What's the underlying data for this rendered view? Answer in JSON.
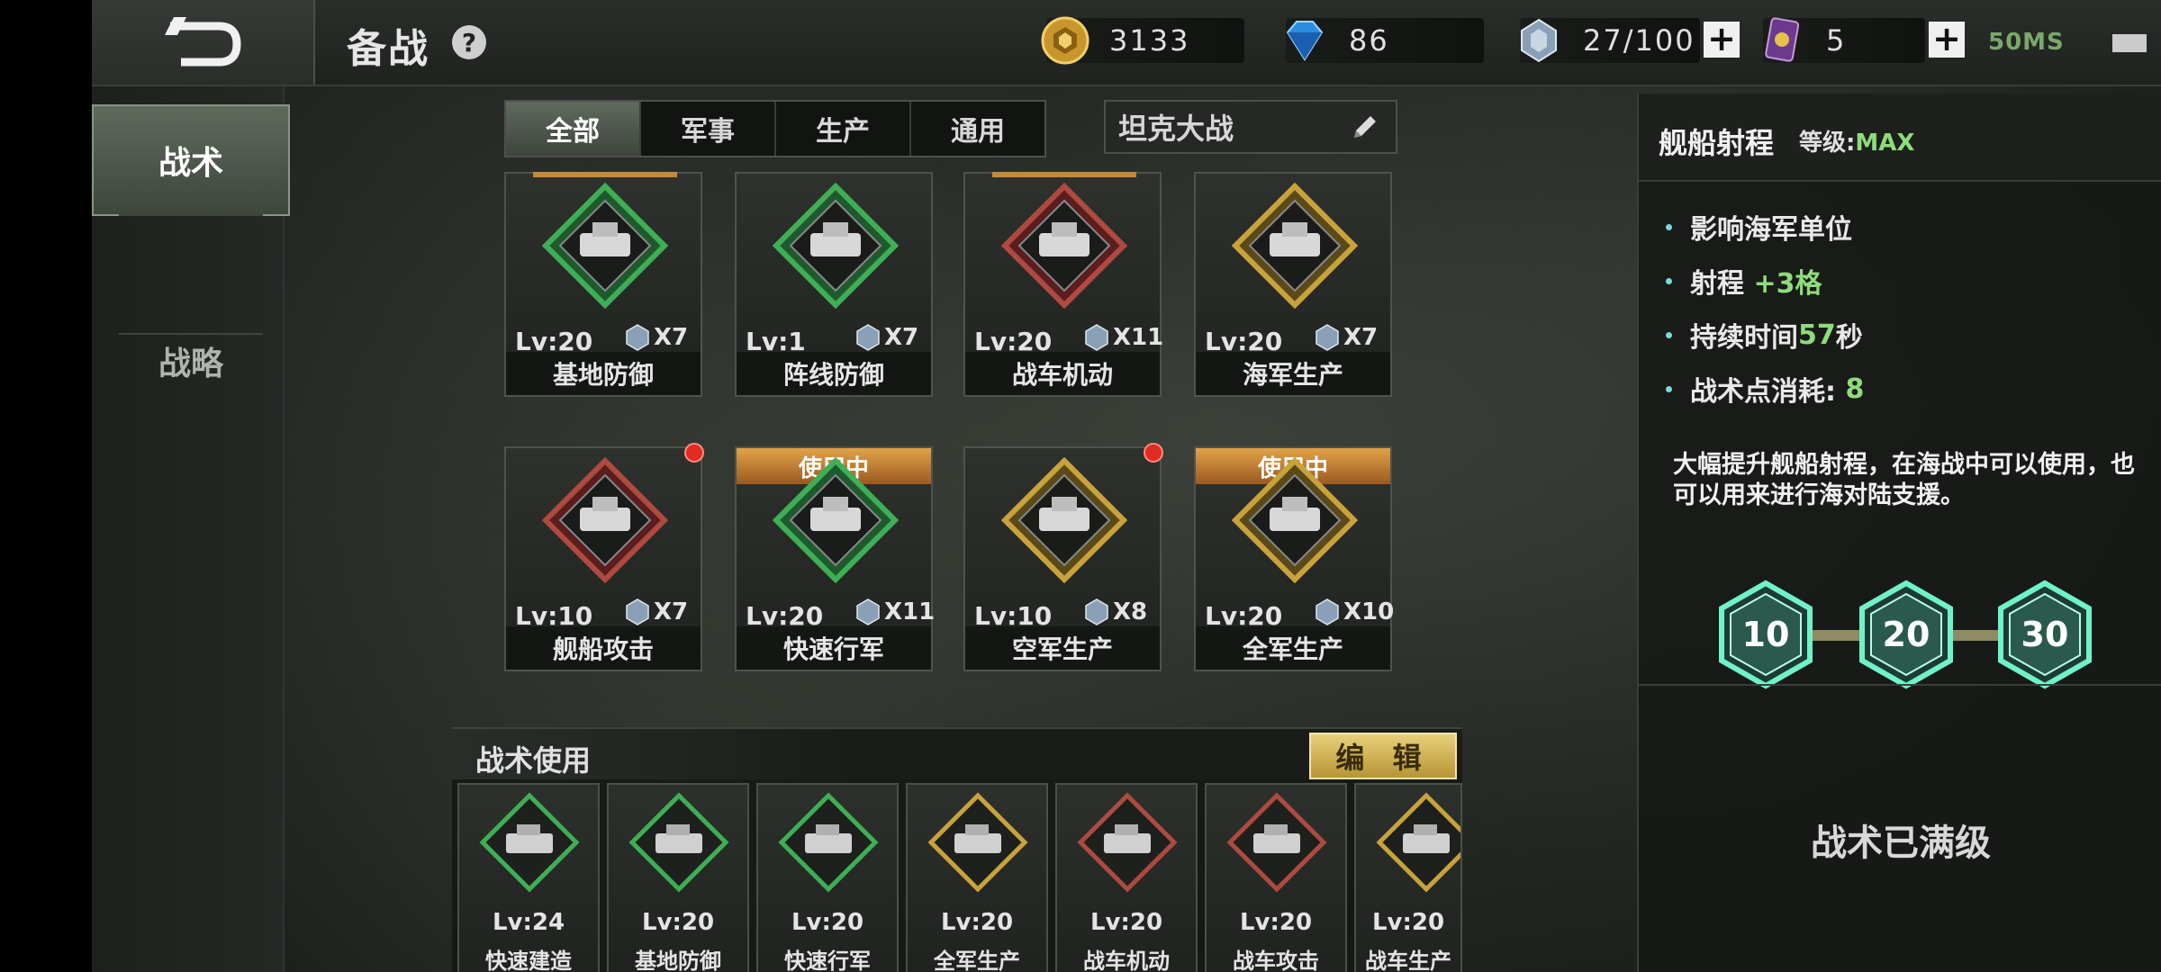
{
  "header": {
    "title": "备战",
    "help": "?",
    "resources": [
      {
        "icon": "gold-coin-icon",
        "value": "3133"
      },
      {
        "icon": "diamond-icon",
        "value": "86"
      },
      {
        "icon": "tactic-crystal-icon",
        "value": "27/100"
      },
      {
        "icon": "card-ticket-icon",
        "value": "5"
      }
    ],
    "ping": "50MS"
  },
  "nav": {
    "items": [
      "战术",
      "战略"
    ]
  },
  "tabs": [
    "全部",
    "军事",
    "生产",
    "通用"
  ],
  "preset": {
    "name": "坦克大战"
  },
  "cards": [
    {
      "name": "基地防御",
      "lv": "Lv:20",
      "cost": "X7"
    },
    {
      "name": "阵线防御",
      "lv": "Lv:1",
      "cost": "X7"
    },
    {
      "name": "战车机动",
      "lv": "Lv:20",
      "cost": "X11"
    },
    {
      "name": "海军生产",
      "lv": "Lv:20",
      "cost": "X7"
    },
    {
      "name": "舰船攻击",
      "lv": "Lv:10",
      "cost": "X7"
    },
    {
      "name": "快速行军",
      "lv": "Lv:20",
      "cost": "X11",
      "badge": "使用中"
    },
    {
      "name": "空军生产",
      "lv": "Lv:10",
      "cost": "X8"
    },
    {
      "name": "全军生产",
      "lv": "Lv:20",
      "cost": "X10",
      "badge": "使用中"
    }
  ],
  "tray": {
    "title": "战术使用",
    "edit": "编 辑",
    "slots": [
      {
        "name": "快速建造",
        "lv": "Lv:24"
      },
      {
        "name": "基地防御",
        "lv": "Lv:20"
      },
      {
        "name": "快速行军",
        "lv": "Lv:20"
      },
      {
        "name": "全军生产",
        "lv": "Lv:20"
      },
      {
        "name": "战车机动",
        "lv": "Lv:20"
      },
      {
        "name": "战车攻击",
        "lv": "Lv:20"
      },
      {
        "name": "战车生产",
        "lv": "Lv:20"
      }
    ]
  },
  "detail": {
    "title": "舰船射程",
    "level_label": "等级:",
    "level_value": "MAX",
    "bullets": [
      {
        "text": "影响海军单位",
        "extra": ""
      },
      {
        "text": "射程 ",
        "extra": "+3格"
      },
      {
        "text": "持续时间",
        "extra": "57",
        "suffix": "秒"
      },
      {
        "text": "战术点消耗: ",
        "extra": "8"
      }
    ],
    "desc": "大幅提升舰船射程，在海战中可以使用，也可以用来进行海对陆支援。",
    "levels": [
      "10",
      "20",
      "30"
    ],
    "status": "战术已满级"
  }
}
